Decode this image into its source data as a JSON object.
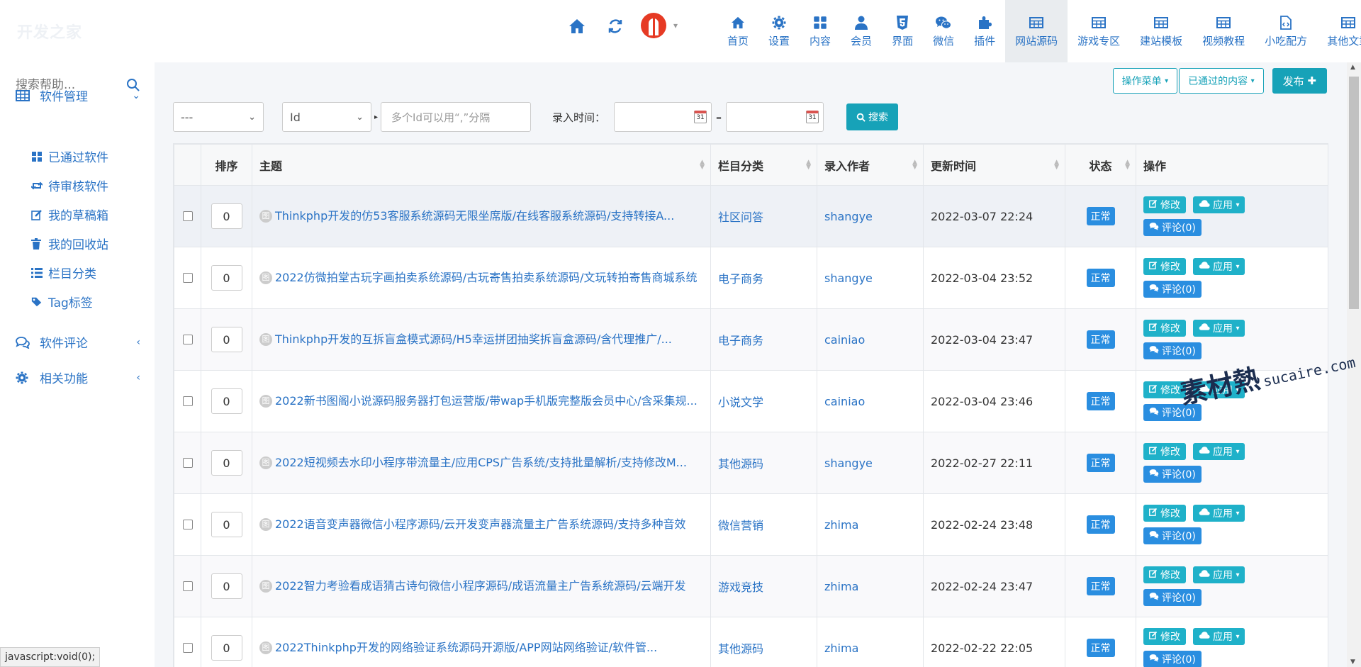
{
  "app": {
    "logo": "开发之家"
  },
  "header": {
    "quick_icons": [
      "home-icon",
      "refresh-icon"
    ],
    "nav": [
      {
        "label": "首页",
        "icon": "home-icon"
      },
      {
        "label": "设置",
        "icon": "gear-icon"
      },
      {
        "label": "内容",
        "icon": "grid-icon"
      },
      {
        "label": "会员",
        "icon": "user-icon"
      },
      {
        "label": "界面",
        "icon": "html5-icon"
      },
      {
        "label": "微信",
        "icon": "wechat-icon"
      },
      {
        "label": "插件",
        "icon": "puzzle-icon"
      },
      {
        "label": "网站源码",
        "icon": "table-icon",
        "active": true
      },
      {
        "label": "游戏专区",
        "icon": "table-icon"
      },
      {
        "label": "建站模板",
        "icon": "table-icon"
      },
      {
        "label": "视频教程",
        "icon": "table-icon"
      },
      {
        "label": "小吃配方",
        "icon": "code-file-icon"
      },
      {
        "label": "其他文章",
        "icon": "table-icon"
      }
    ]
  },
  "sidebar": {
    "search_placeholder": "搜索帮助...",
    "groups": [
      {
        "label": "软件管理",
        "icon": "table-icon",
        "expanded": true
      },
      {
        "label": "软件评论",
        "icon": "comments-icon",
        "expanded": false
      },
      {
        "label": "相关功能",
        "icon": "gear-icon",
        "expanded": false
      }
    ],
    "items": [
      {
        "label": "已通过软件",
        "icon": "grid-icon"
      },
      {
        "label": "待审核软件",
        "icon": "retweet-icon"
      },
      {
        "label": "我的草稿箱",
        "icon": "edit-icon"
      },
      {
        "label": "我的回收站",
        "icon": "trash-icon"
      },
      {
        "label": "栏目分类",
        "icon": "list-icon"
      },
      {
        "label": "Tag标签",
        "icon": "tags-icon"
      }
    ]
  },
  "toolbar": {
    "ops_menu": "操作菜单",
    "passed_content": "已通过的内容",
    "publish": "发布"
  },
  "filter": {
    "select1": "---",
    "select2": "Id",
    "ids_placeholder": "多个Id可以用“,”分隔",
    "time_label": "录入时间：",
    "search_btn": "搜索",
    "cal_day": "31"
  },
  "table": {
    "headers": [
      "排序",
      "主题",
      "栏目分类",
      "录入作者",
      "更新时间",
      "状态",
      "操作"
    ],
    "edit_label": "修改",
    "apply_label": "应用",
    "tag_glyph": "图",
    "rows": [
      {
        "order": "0",
        "subject": "Thinkphp开发的仿53客服系统源码无限坐席版/在线客服系统源码/支持转接A...",
        "category": "社区问答",
        "author": "shangye",
        "updated": "2022-03-07 22:24",
        "status": "正常",
        "comments": "评论(0)"
      },
      {
        "order": "0",
        "subject": "2022仿微拍堂古玩字画拍卖系统源码/古玩寄售拍卖系统源码/文玩转拍寄售商城系统",
        "category": "电子商务",
        "author": "shangye",
        "updated": "2022-03-04 23:52",
        "status": "正常",
        "comments": "评论(0)"
      },
      {
        "order": "0",
        "subject": "Thinkphp开发的互拆盲盒模式源码/H5幸运拼团抽奖拆盲盒源码/含代理推广/...",
        "category": "电子商务",
        "author": "cainiao",
        "updated": "2022-03-04 23:47",
        "status": "正常",
        "comments": "评论(0)"
      },
      {
        "order": "0",
        "subject": "2022新书图阁小说源码服务器打包运营版/带wap手机版完整版会员中心/含采集规...",
        "category": "小说文学",
        "author": "cainiao",
        "updated": "2022-03-04 23:46",
        "status": "正常",
        "comments": "评论(0)"
      },
      {
        "order": "0",
        "subject": "2022短视频去水印小程序带流量主/应用CPS广告系统/支持批量解析/支持修改M...",
        "category": "其他源码",
        "author": "shangye",
        "updated": "2022-02-27 22:11",
        "status": "正常",
        "comments": "评论(0)"
      },
      {
        "order": "0",
        "subject": "2022语音变声器微信小程序源码/云开发变声器流量主广告系统源码/支持多种音效",
        "category": "微信营销",
        "author": "zhima",
        "updated": "2022-02-24 23:48",
        "status": "正常",
        "comments": "评论(0)"
      },
      {
        "order": "0",
        "subject": "2022智力考验看成语猜古诗句微信小程序源码/成语流量主广告系统源码/云端开发",
        "category": "游戏竞技",
        "author": "zhima",
        "updated": "2022-02-24 23:47",
        "status": "正常",
        "comments": "评论(0)"
      },
      {
        "order": "0",
        "subject": "2022Thinkphp开发的网络验证系统源码开源版/APP网站网络验证/软件管...",
        "category": "其他源码",
        "author": "zhima",
        "updated": "2022-02-22 22:05",
        "status": "正常",
        "comments": "评论(0)"
      }
    ]
  },
  "status_bar": "javascript:void(0);",
  "watermark": {
    "main": "素材熱",
    "sub": "sucaire.com"
  },
  "colors": {
    "accent": "#2a73c5",
    "teal": "#17a2b8",
    "badge": "#2a8ee0"
  }
}
